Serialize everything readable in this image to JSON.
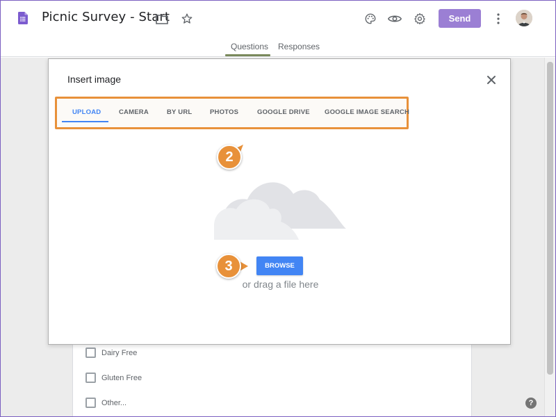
{
  "app": {
    "title": "Picnic Survey - Start",
    "send_label": "Send",
    "tabs": [
      {
        "label": "Questions"
      },
      {
        "label": "Responses"
      }
    ],
    "accent_color": "#9b7fd4"
  },
  "dialog": {
    "title": "Insert image",
    "tabs": [
      {
        "label": "UPLOAD",
        "active": true
      },
      {
        "label": "CAMERA"
      },
      {
        "label": "BY URL"
      },
      {
        "label": "PHOTOS"
      },
      {
        "label": "GOOGLE DRIVE"
      },
      {
        "label": "GOOGLE IMAGE SEARCH"
      }
    ],
    "browse_label": "BROWSE",
    "drag_text": "or drag a file here",
    "highlight_color": "#e8913a",
    "primary_color": "#4285f4"
  },
  "callouts": [
    {
      "number": "2"
    },
    {
      "number": "3"
    }
  ],
  "form": {
    "options": [
      {
        "label": "Dairy Free"
      },
      {
        "label": "Gluten Free"
      },
      {
        "label": "Other..."
      }
    ]
  },
  "help": {
    "label": "?"
  }
}
